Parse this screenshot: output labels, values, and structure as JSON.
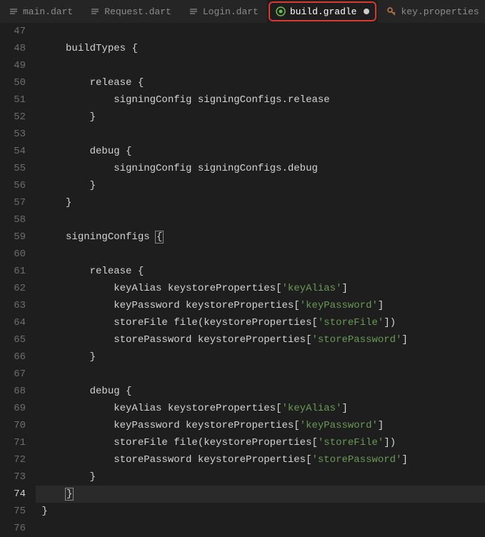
{
  "tabs": [
    {
      "label": "main.dart",
      "icon": "dart",
      "active": false,
      "dirty": false
    },
    {
      "label": "Request.dart",
      "icon": "dart",
      "active": false,
      "dirty": false
    },
    {
      "label": "Login.dart",
      "icon": "dart",
      "active": false,
      "dirty": false
    },
    {
      "label": "build.gradle",
      "icon": "gradle",
      "active": true,
      "dirty": true,
      "highlighted": true
    },
    {
      "label": "key.properties",
      "icon": "key",
      "active": false,
      "dirty": false
    }
  ],
  "gutter": {
    "start": 47,
    "end": 76,
    "current": 74
  },
  "code": {
    "lines": [
      {
        "n": 47,
        "indent": 0,
        "tokens": []
      },
      {
        "n": 48,
        "indent": 1,
        "tokens": [
          [
            "id",
            "buildTypes "
          ],
          [
            "p",
            "{"
          ]
        ]
      },
      {
        "n": 49,
        "indent": 2,
        "tokens": []
      },
      {
        "n": 50,
        "indent": 2,
        "tokens": [
          [
            "id",
            "release "
          ],
          [
            "p",
            "{"
          ]
        ]
      },
      {
        "n": 51,
        "indent": 3,
        "tokens": [
          [
            "id",
            "signingConfig signingConfigs"
          ],
          [
            "p",
            "."
          ],
          [
            "id",
            "release"
          ]
        ]
      },
      {
        "n": 52,
        "indent": 2,
        "tokens": [
          [
            "p",
            "}"
          ]
        ]
      },
      {
        "n": 53,
        "indent": 2,
        "tokens": []
      },
      {
        "n": 54,
        "indent": 2,
        "tokens": [
          [
            "id",
            "debug "
          ],
          [
            "p",
            "{"
          ]
        ]
      },
      {
        "n": 55,
        "indent": 3,
        "tokens": [
          [
            "id",
            "signingConfig signingConfigs"
          ],
          [
            "p",
            "."
          ],
          [
            "id",
            "debug"
          ]
        ]
      },
      {
        "n": 56,
        "indent": 2,
        "tokens": [
          [
            "p",
            "}"
          ]
        ]
      },
      {
        "n": 57,
        "indent": 1,
        "tokens": [
          [
            "p",
            "}"
          ]
        ]
      },
      {
        "n": 58,
        "indent": 1,
        "tokens": []
      },
      {
        "n": 59,
        "indent": 1,
        "tokens": [
          [
            "id",
            "signingConfigs "
          ],
          [
            "cursor",
            "{"
          ]
        ]
      },
      {
        "n": 60,
        "indent": 2,
        "tokens": []
      },
      {
        "n": 61,
        "indent": 2,
        "tokens": [
          [
            "id",
            "release "
          ],
          [
            "p",
            "{"
          ]
        ]
      },
      {
        "n": 62,
        "indent": 3,
        "tokens": [
          [
            "id",
            "keyAlias keystoreProperties"
          ],
          [
            "p",
            "["
          ],
          [
            "s",
            "'keyAlias'"
          ],
          [
            "p",
            "]"
          ]
        ]
      },
      {
        "n": 63,
        "indent": 3,
        "tokens": [
          [
            "id",
            "keyPassword keystoreProperties"
          ],
          [
            "p",
            "["
          ],
          [
            "s",
            "'keyPassword'"
          ],
          [
            "p",
            "]"
          ]
        ]
      },
      {
        "n": 64,
        "indent": 3,
        "tokens": [
          [
            "id",
            "storeFile file"
          ],
          [
            "p",
            "("
          ],
          [
            "id",
            "keystoreProperties"
          ],
          [
            "p",
            "["
          ],
          [
            "s",
            "'storeFile'"
          ],
          [
            "p",
            "])"
          ]
        ]
      },
      {
        "n": 65,
        "indent": 3,
        "tokens": [
          [
            "id",
            "storePassword keystoreProperties"
          ],
          [
            "p",
            "["
          ],
          [
            "s",
            "'storePassword'"
          ],
          [
            "p",
            "]"
          ]
        ]
      },
      {
        "n": 66,
        "indent": 2,
        "tokens": [
          [
            "p",
            "}"
          ]
        ]
      },
      {
        "n": 67,
        "indent": 2,
        "tokens": []
      },
      {
        "n": 68,
        "indent": 2,
        "tokens": [
          [
            "id",
            "debug "
          ],
          [
            "p",
            "{"
          ]
        ]
      },
      {
        "n": 69,
        "indent": 3,
        "tokens": [
          [
            "id",
            "keyAlias keystoreProperties"
          ],
          [
            "p",
            "["
          ],
          [
            "s",
            "'keyAlias'"
          ],
          [
            "p",
            "]"
          ]
        ]
      },
      {
        "n": 70,
        "indent": 3,
        "tokens": [
          [
            "id",
            "keyPassword keystoreProperties"
          ],
          [
            "p",
            "["
          ],
          [
            "s",
            "'keyPassword'"
          ],
          [
            "p",
            "]"
          ]
        ]
      },
      {
        "n": 71,
        "indent": 3,
        "tokens": [
          [
            "id",
            "storeFile file"
          ],
          [
            "p",
            "("
          ],
          [
            "id",
            "keystoreProperties"
          ],
          [
            "p",
            "["
          ],
          [
            "s",
            "'storeFile'"
          ],
          [
            "p",
            "])"
          ]
        ]
      },
      {
        "n": 72,
        "indent": 3,
        "tokens": [
          [
            "id",
            "storePassword keystoreProperties"
          ],
          [
            "p",
            "["
          ],
          [
            "s",
            "'storePassword'"
          ],
          [
            "p",
            "]"
          ]
        ]
      },
      {
        "n": 73,
        "indent": 2,
        "tokens": [
          [
            "p",
            "}"
          ]
        ]
      },
      {
        "n": 74,
        "indent": 1,
        "tokens": [
          [
            "cursor",
            "}"
          ]
        ],
        "current": true
      },
      {
        "n": 75,
        "indent": 0,
        "tokens": [
          [
            "p",
            "}"
          ]
        ]
      },
      {
        "n": 76,
        "indent": 0,
        "tokens": []
      }
    ]
  },
  "icons": {
    "dart": "≡",
    "gradle": "◎",
    "key": "⚿"
  }
}
